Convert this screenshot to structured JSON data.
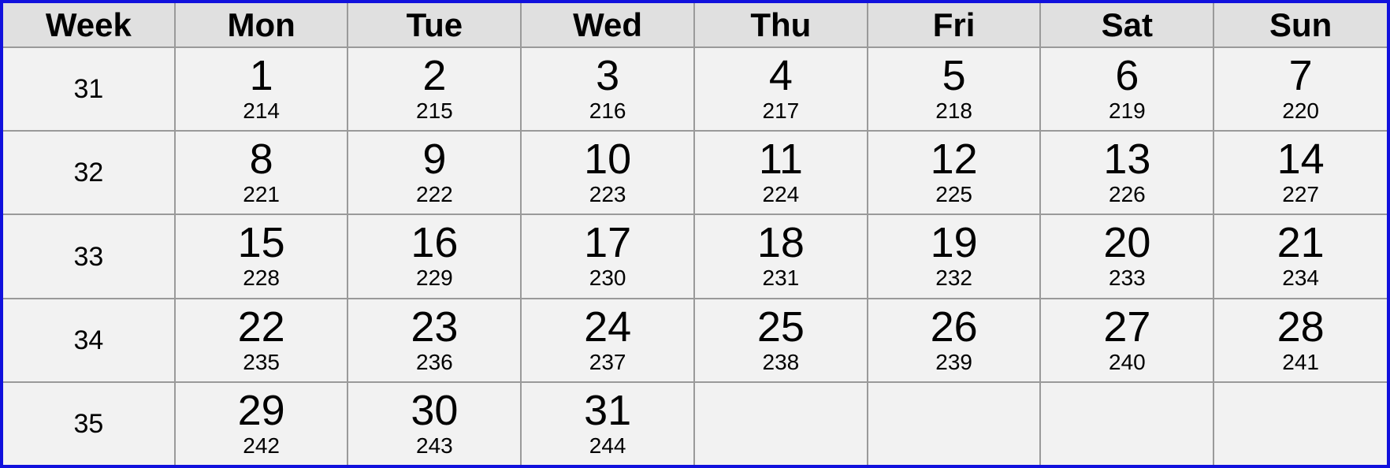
{
  "header": {
    "week_label": "Week",
    "days": [
      "Mon",
      "Tue",
      "Wed",
      "Thu",
      "Fri",
      "Sat",
      "Sun"
    ]
  },
  "weeks": [
    {
      "week": "31",
      "days": [
        {
          "day": "1",
          "doy": "214"
        },
        {
          "day": "2",
          "doy": "215"
        },
        {
          "day": "3",
          "doy": "216"
        },
        {
          "day": "4",
          "doy": "217"
        },
        {
          "day": "5",
          "doy": "218"
        },
        {
          "day": "6",
          "doy": "219"
        },
        {
          "day": "7",
          "doy": "220"
        }
      ]
    },
    {
      "week": "32",
      "days": [
        {
          "day": "8",
          "doy": "221"
        },
        {
          "day": "9",
          "doy": "222"
        },
        {
          "day": "10",
          "doy": "223"
        },
        {
          "day": "11",
          "doy": "224"
        },
        {
          "day": "12",
          "doy": "225"
        },
        {
          "day": "13",
          "doy": "226"
        },
        {
          "day": "14",
          "doy": "227"
        }
      ]
    },
    {
      "week": "33",
      "days": [
        {
          "day": "15",
          "doy": "228"
        },
        {
          "day": "16",
          "doy": "229"
        },
        {
          "day": "17",
          "doy": "230"
        },
        {
          "day": "18",
          "doy": "231"
        },
        {
          "day": "19",
          "doy": "232"
        },
        {
          "day": "20",
          "doy": "233"
        },
        {
          "day": "21",
          "doy": "234"
        }
      ]
    },
    {
      "week": "34",
      "days": [
        {
          "day": "22",
          "doy": "235"
        },
        {
          "day": "23",
          "doy": "236"
        },
        {
          "day": "24",
          "doy": "237"
        },
        {
          "day": "25",
          "doy": "238"
        },
        {
          "day": "26",
          "doy": "239"
        },
        {
          "day": "27",
          "doy": "240"
        },
        {
          "day": "28",
          "doy": "241"
        }
      ]
    },
    {
      "week": "35",
      "days": [
        {
          "day": "29",
          "doy": "242"
        },
        {
          "day": "30",
          "doy": "243"
        },
        {
          "day": "31",
          "doy": "244"
        },
        {
          "day": "",
          "doy": ""
        },
        {
          "day": "",
          "doy": ""
        },
        {
          "day": "",
          "doy": ""
        },
        {
          "day": "",
          "doy": ""
        }
      ]
    }
  ],
  "colors": {
    "frame": "#1111dd",
    "header_bg": "#e0e0e0",
    "cell_bg": "#f2f2f2",
    "grid": "#9a9a9a"
  }
}
